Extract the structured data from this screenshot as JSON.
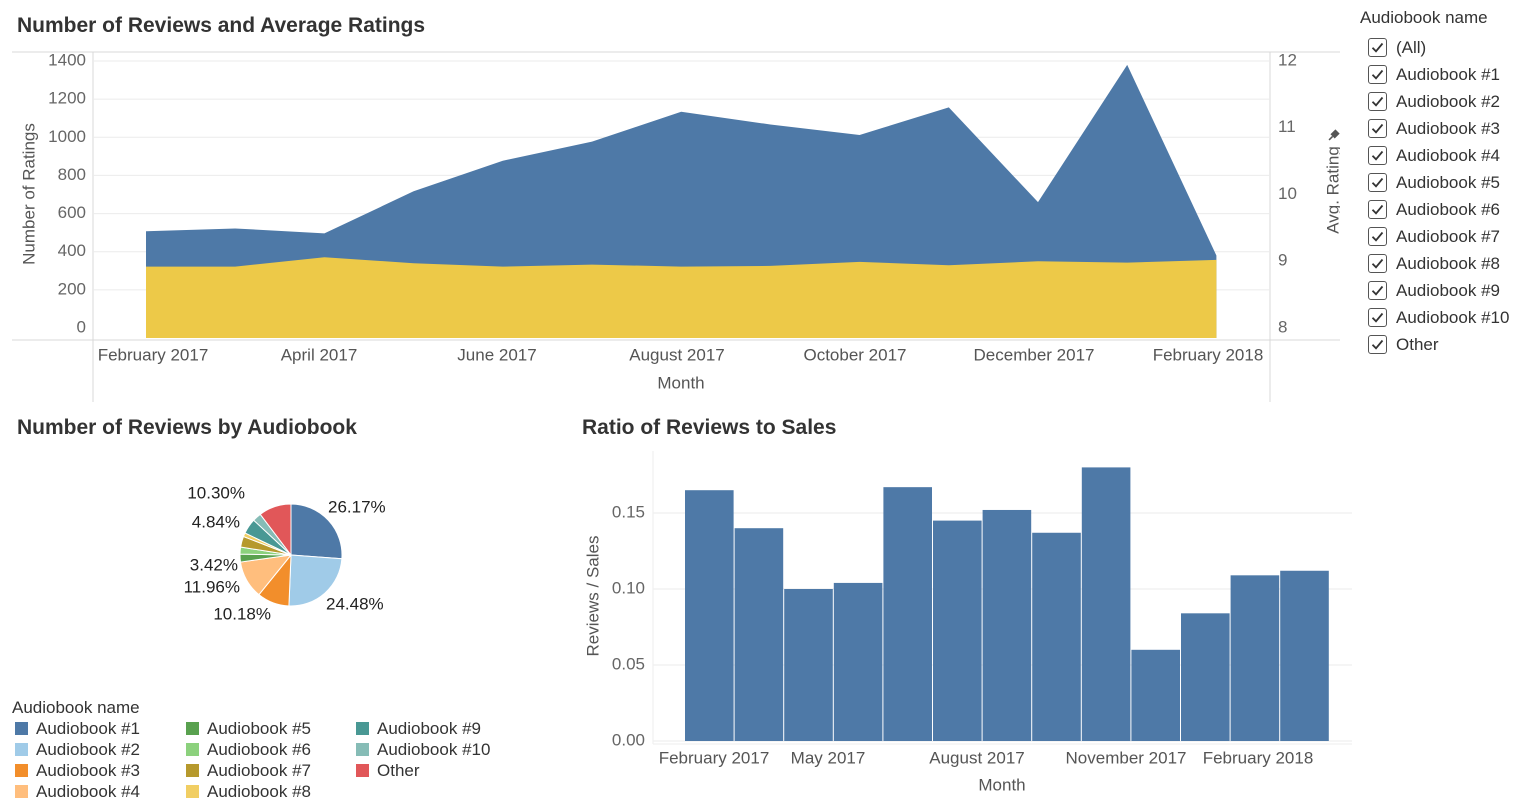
{
  "dashboard": {
    "title_top": "Number of Reviews and Average Ratings",
    "title_pie": "Number of Reviews by Audiobook",
    "title_bar": "Ratio of Reviews to Sales"
  },
  "colors": {
    "reviews_area": "#4e79a7",
    "rating_area": "#edc948",
    "bars": "#4e79a7",
    "grid": "#ebebeb",
    "axis_text": "#666666"
  },
  "filter": {
    "title": "Audiobook name",
    "items": [
      {
        "label": "(All)",
        "checked": true
      },
      {
        "label": "Audiobook #1",
        "checked": true
      },
      {
        "label": "Audiobook #2",
        "checked": true
      },
      {
        "label": "Audiobook #3",
        "checked": true
      },
      {
        "label": "Audiobook #4",
        "checked": true
      },
      {
        "label": "Audiobook #5",
        "checked": true
      },
      {
        "label": "Audiobook #6",
        "checked": true
      },
      {
        "label": "Audiobook #7",
        "checked": true
      },
      {
        "label": "Audiobook #8",
        "checked": true
      },
      {
        "label": "Audiobook #9",
        "checked": true
      },
      {
        "label": "Audiobook #10",
        "checked": true
      },
      {
        "label": "Other",
        "checked": true
      }
    ]
  },
  "legend": {
    "title": "Audiobook name",
    "items": [
      {
        "label": "Audiobook #1",
        "color": "#4e79a7"
      },
      {
        "label": "Audiobook #2",
        "color": "#a0cbe8"
      },
      {
        "label": "Audiobook #3",
        "color": "#f28e2b"
      },
      {
        "label": "Audiobook #4",
        "color": "#ffbe7d"
      },
      {
        "label": "Audiobook #5",
        "color": "#59a14f"
      },
      {
        "label": "Audiobook #6",
        "color": "#8cd17d"
      },
      {
        "label": "Audiobook #7",
        "color": "#b6992d"
      },
      {
        "label": "Audiobook #8",
        "color": "#f1ce63"
      },
      {
        "label": "Audiobook #9",
        "color": "#499894"
      },
      {
        "label": "Audiobook #10",
        "color": "#86bcb6"
      },
      {
        "label": "Other",
        "color": "#e15759"
      }
    ]
  },
  "chart_data": [
    {
      "type": "area",
      "title": "Number of Reviews and Average Ratings",
      "xlabel": "Month",
      "ylabel": "Number of Ratings",
      "y2label": "Avg. Rating",
      "x": [
        "2017-01",
        "2017-02",
        "2017-03",
        "2017-04",
        "2017-05",
        "2017-06",
        "2017-07",
        "2017-08",
        "2017-09",
        "2017-10",
        "2017-11",
        "2017-12",
        "2018-01",
        "2018-02"
      ],
      "x_ticks": [
        "February 2017",
        "April 2017",
        "June 2017",
        "August 2017",
        "October 2017",
        "December 2017",
        "February 2018"
      ],
      "y_ticks": [
        0,
        200,
        400,
        600,
        800,
        1000,
        1200,
        1400
      ],
      "y2_ticks": [
        8,
        9,
        10,
        11,
        12
      ],
      "ylim": [
        -50,
        1400
      ],
      "y2lim": [
        7.85,
        12
      ],
      "series": [
        {
          "name": "Number of Ratings",
          "axis": "left",
          "values": [
            507,
            522,
            496,
            717,
            877,
            977,
            1134,
            1067,
            1012,
            1157,
            660,
            1380,
            380
          ]
        },
        {
          "name": "Avg. Rating",
          "axis": "right",
          "values": [
            8.92,
            8.92,
            9.06,
            8.97,
            8.92,
            8.95,
            8.92,
            8.93,
            8.99,
            8.94,
            9.0,
            8.98,
            9.02
          ]
        }
      ]
    },
    {
      "type": "pie",
      "title": "Number of Reviews by Audiobook",
      "slices": [
        {
          "name": "Audiobook #1",
          "value": 26.17,
          "label": "26.17%"
        },
        {
          "name": "Audiobook #2",
          "value": 24.48,
          "label": "24.48%"
        },
        {
          "name": "Audiobook #3",
          "value": 10.18,
          "label": "10.18%"
        },
        {
          "name": "Audiobook #4",
          "value": 11.96,
          "label": "11.96%"
        },
        {
          "name": "Audiobook #5",
          "value": 2.5,
          "label": ""
        },
        {
          "name": "Audiobook #6",
          "value": 2.2,
          "label": ""
        },
        {
          "name": "Audiobook #7",
          "value": 3.42,
          "label": "3.42%"
        },
        {
          "name": "Audiobook #8",
          "value": 1.2,
          "label": ""
        },
        {
          "name": "Audiobook #9",
          "value": 4.84,
          "label": "4.84%"
        },
        {
          "name": "Audiobook #10",
          "value": 2.75,
          "label": ""
        },
        {
          "name": "Other",
          "value": 10.3,
          "label": "10.30%"
        }
      ]
    },
    {
      "type": "bar",
      "title": "Ratio of Reviews to Sales",
      "xlabel": "Month",
      "ylabel": "Reviews / Sales",
      "categories": [
        "2017-01",
        "2017-02",
        "2017-03",
        "2017-04",
        "2017-05",
        "2017-06",
        "2017-07",
        "2017-08",
        "2017-09",
        "2017-10",
        "2017-11",
        "2017-12",
        "2018-01"
      ],
      "x_ticks": [
        "February 2017",
        "May 2017",
        "August 2017",
        "November 2017",
        "February 2018"
      ],
      "values": [
        0.165,
        0.14,
        0.1,
        0.104,
        0.167,
        0.145,
        0.152,
        0.137,
        0.18,
        0.06,
        0.084,
        0.109,
        0.112
      ],
      "y_ticks": [
        "0.00",
        "0.05",
        "0.10",
        "0.15"
      ],
      "ylim": [
        0,
        0.19
      ]
    }
  ]
}
